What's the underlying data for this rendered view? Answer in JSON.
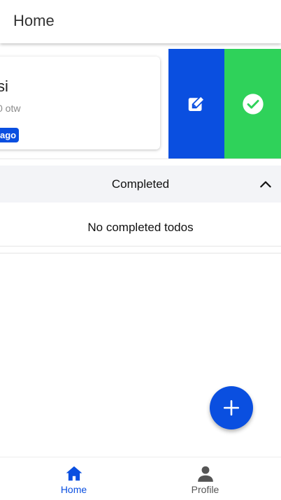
{
  "header": {
    "title": "Home"
  },
  "todo": {
    "title": "si",
    "meta": "0 otw",
    "badge": "ago"
  },
  "actions": {
    "edit_icon": "edit-icon",
    "complete_icon": "check-circle-icon"
  },
  "completed_section": {
    "label": "Completed",
    "empty_message": "No completed todos"
  },
  "fab": {
    "icon": "plus-icon"
  },
  "bottom_nav": {
    "items": [
      {
        "label": "Home",
        "icon": "home-icon",
        "active": true
      },
      {
        "label": "Profile",
        "icon": "person-icon",
        "active": false
      }
    ]
  },
  "colors": {
    "primary": "#0a4fe0",
    "success": "#2fd25a",
    "section_bg": "#f3f4f7"
  }
}
